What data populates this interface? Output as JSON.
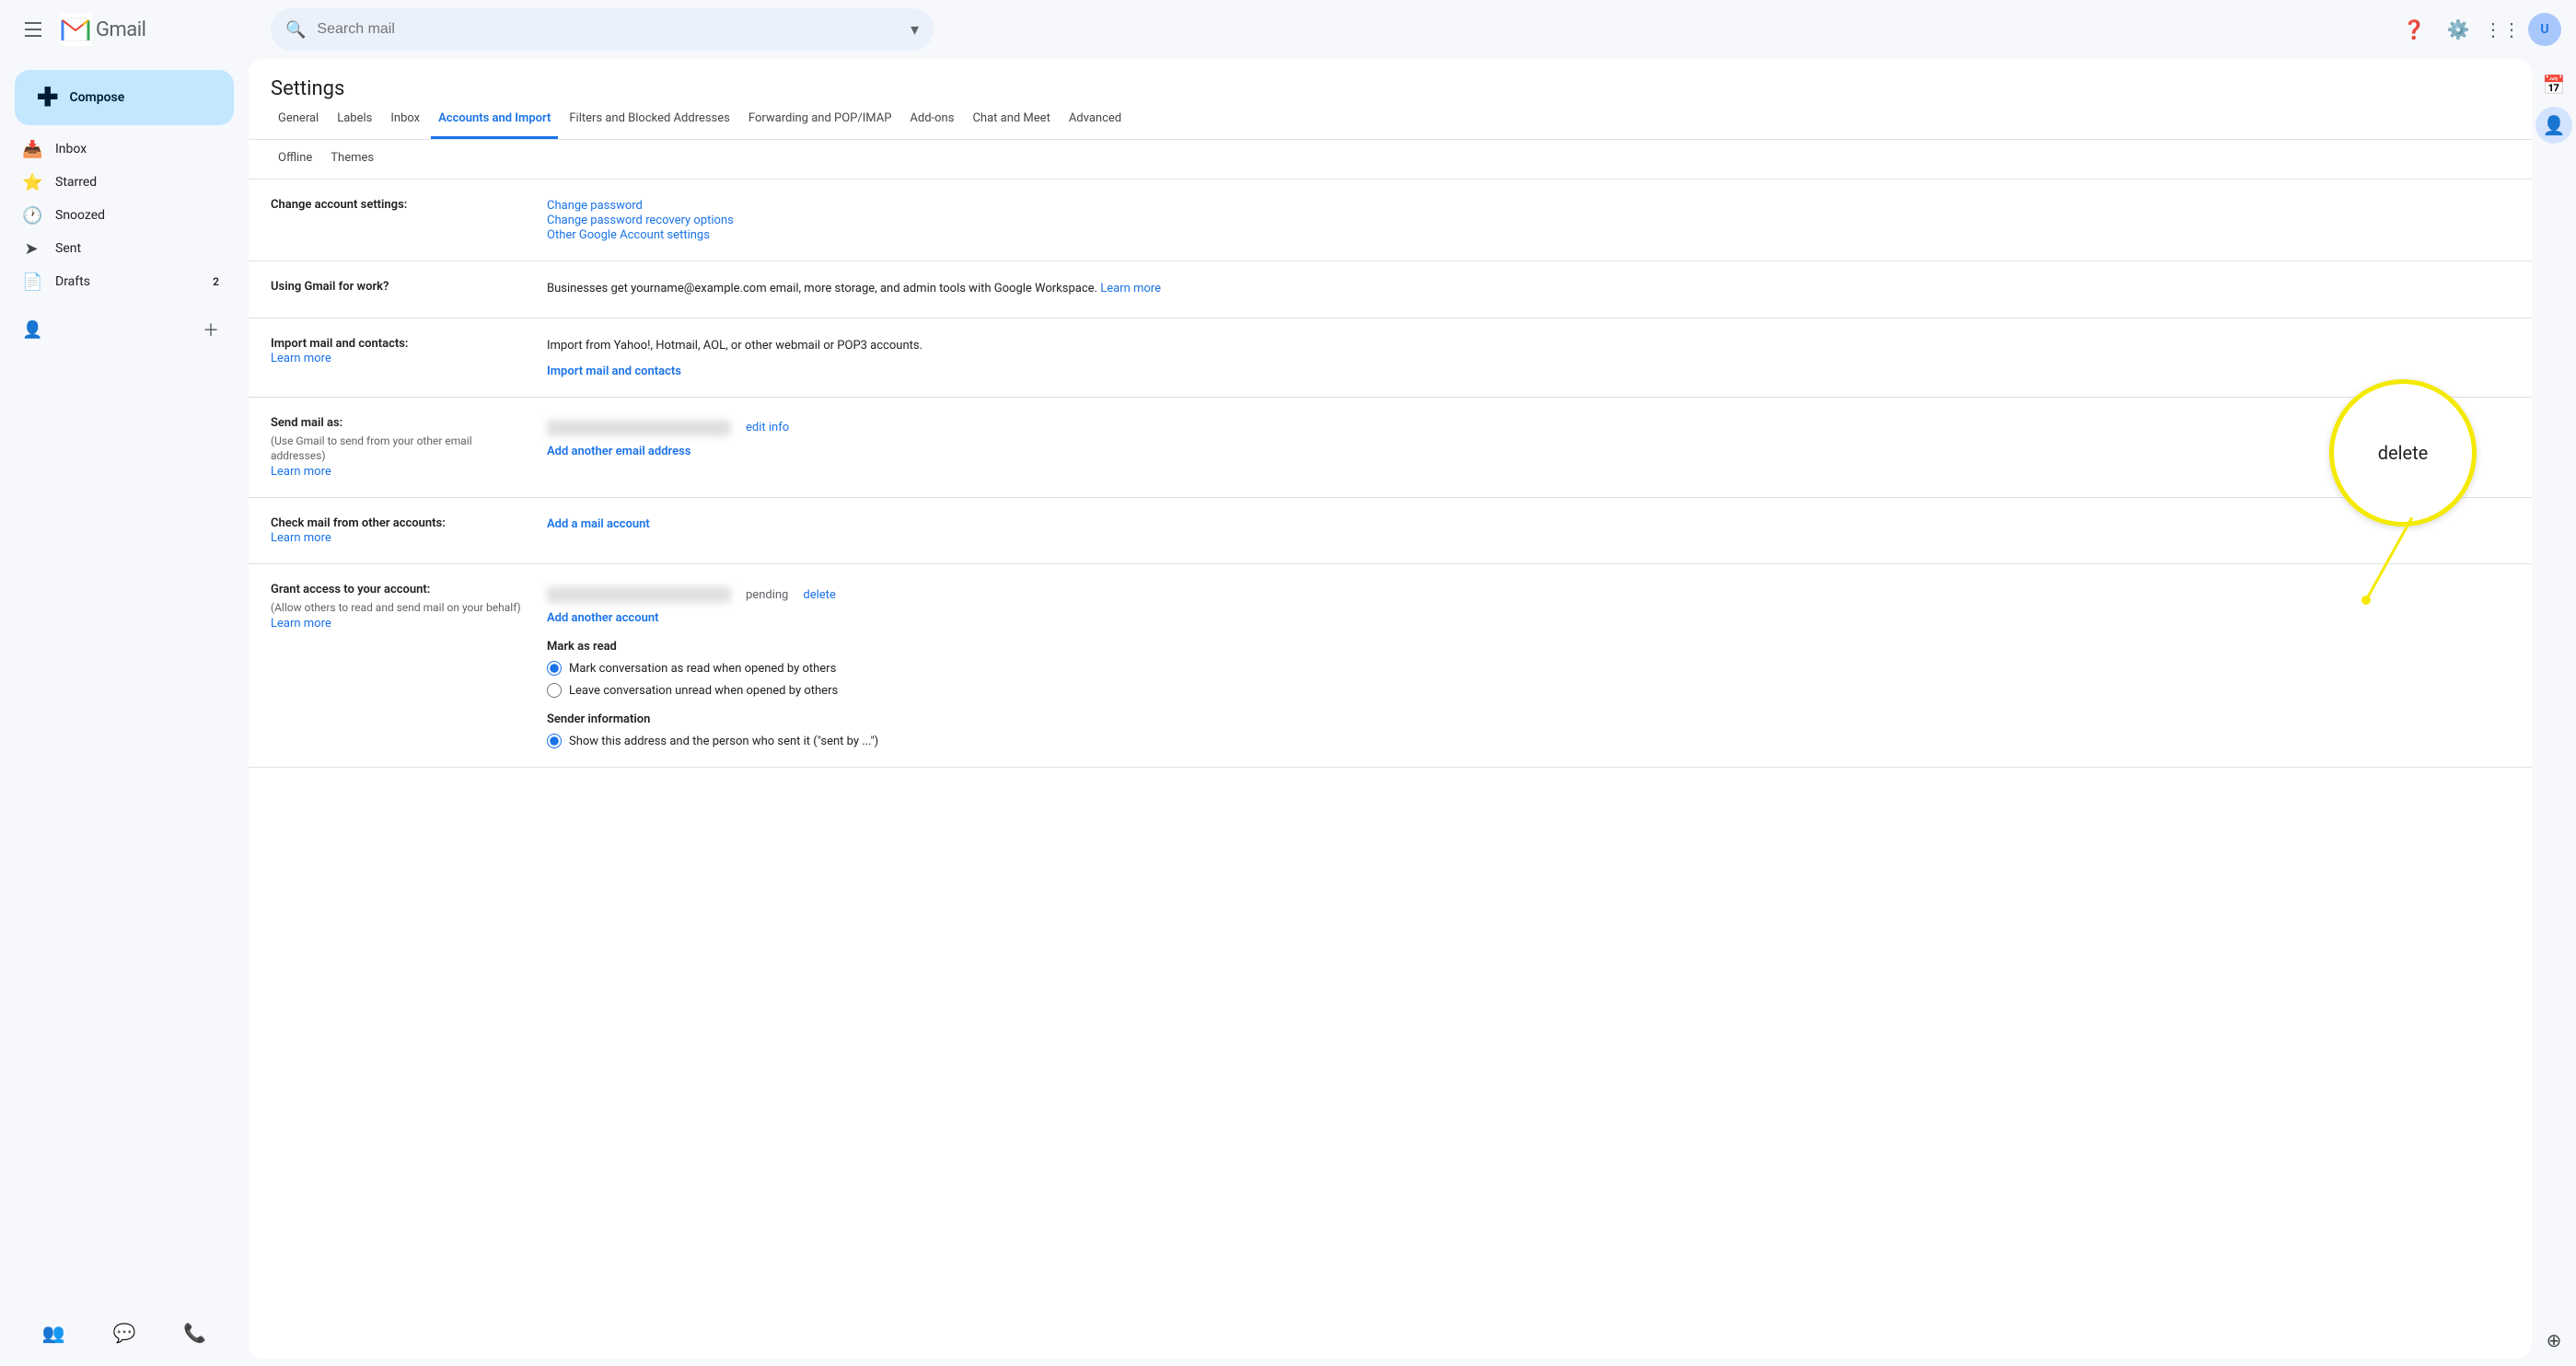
{
  "topbar": {
    "search_placeholder": "Search mail",
    "gmail_label": "Gmail"
  },
  "sidebar": {
    "compose_label": "Compose",
    "nav_items": [
      {
        "id": "inbox",
        "label": "Inbox",
        "icon": "📥",
        "badge": ""
      },
      {
        "id": "starred",
        "label": "Starred",
        "icon": "⭐",
        "badge": ""
      },
      {
        "id": "snoozed",
        "label": "Snoozed",
        "icon": "🕐",
        "badge": ""
      },
      {
        "id": "sent",
        "label": "Sent",
        "icon": "➤",
        "badge": ""
      },
      {
        "id": "drafts",
        "label": "Drafts",
        "icon": "📄",
        "badge": "2"
      }
    ]
  },
  "settings": {
    "title": "Settings",
    "tabs": [
      {
        "id": "general",
        "label": "General",
        "active": false
      },
      {
        "id": "labels",
        "label": "Labels",
        "active": false
      },
      {
        "id": "inbox",
        "label": "Inbox",
        "active": false
      },
      {
        "id": "accounts",
        "label": "Accounts and Import",
        "active": true
      },
      {
        "id": "filters",
        "label": "Filters and Blocked Addresses",
        "active": false
      },
      {
        "id": "forwarding",
        "label": "Forwarding and POP/IMAP",
        "active": false
      },
      {
        "id": "addons",
        "label": "Add-ons",
        "active": false
      },
      {
        "id": "chat",
        "label": "Chat and Meet",
        "active": false
      },
      {
        "id": "advanced",
        "label": "Advanced",
        "active": false
      }
    ],
    "tabs2": [
      {
        "id": "offline",
        "label": "Offline"
      },
      {
        "id": "themes",
        "label": "Themes"
      }
    ],
    "rows": [
      {
        "id": "change-account",
        "label": "Change account settings:",
        "links": [
          {
            "text": "Change password",
            "href": "#"
          },
          {
            "text": "Change password recovery options",
            "href": "#"
          },
          {
            "text": "Other Google Account settings",
            "href": "#"
          }
        ]
      },
      {
        "id": "gmail-work",
        "label": "Using Gmail for work?",
        "text": "Businesses get yourname@example.com email, more storage, and admin tools with Google Workspace.",
        "learn_more": "Learn more"
      },
      {
        "id": "import-mail",
        "label": "Import mail and contacts:",
        "sublabel": "Learn more",
        "description": "Import from Yahoo!, Hotmail, AOL, or other webmail or POP3 accounts.",
        "action_link": "Import mail and contacts"
      },
      {
        "id": "send-mail-as",
        "label": "Send mail as:",
        "sublabel_text": "(Use Gmail to send from your other email addresses)",
        "learn_more": "Learn more",
        "edit_info": "edit info",
        "action_link": "Add another email address",
        "has_blurred": true
      },
      {
        "id": "check-mail",
        "label": "Check mail from other accounts:",
        "learn_more": "Learn more",
        "action_link": "Add a mail account"
      },
      {
        "id": "grant-access",
        "label": "Grant access to your account:",
        "sublabel_text": "(Allow others to read and send mail on your behalf)",
        "learn_more": "Learn more",
        "pending": "pending",
        "delete_link": "delete",
        "action_link": "Add another account",
        "has_blurred": true,
        "mark_as_read_title": "Mark as read",
        "radio_options": [
          {
            "id": "mark-read",
            "label": "Mark conversation as read when opened by others",
            "checked": true
          },
          {
            "id": "leave-unread",
            "label": "Leave conversation unread when opened by others",
            "checked": false
          }
        ],
        "sender_info_title": "Sender information",
        "sender_radio_options": [
          {
            "id": "show-sender",
            "label": "Show this address and the person who sent it (\"sent by ...\")",
            "checked": true
          }
        ]
      }
    ],
    "annotation_label": "delete"
  }
}
